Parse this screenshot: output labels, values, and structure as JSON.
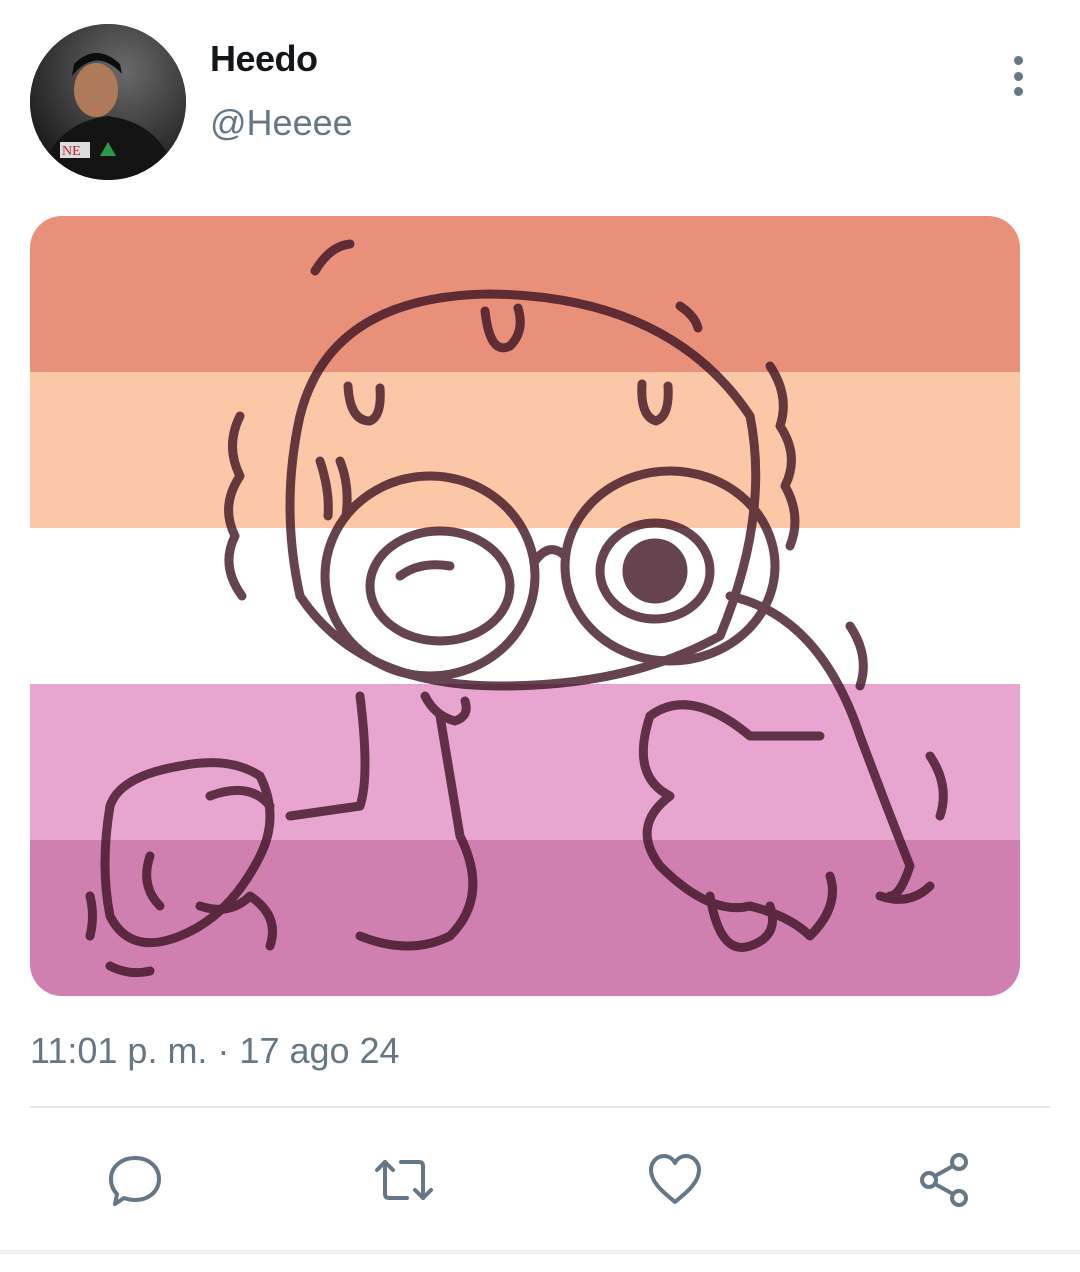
{
  "tweet": {
    "author": {
      "display_name": "Heedo",
      "handle": "@Heeee"
    },
    "media": {
      "flag_colors": [
        "#e8907a",
        "#fbc7a6",
        "#ffffff",
        "#e8a5cf",
        "#d07fb1"
      ],
      "drawing_color": "#3a1020"
    },
    "timestamp": "11:01 p. m. · 17 ago 24"
  },
  "actions": {
    "reply_icon": "speech-bubble-icon",
    "retweet_icon": "retweet-arrows-icon",
    "like_icon": "heart-outline-icon",
    "share_icon": "share-nodes-icon"
  },
  "colors": {
    "text_primary": "#14171a",
    "text_secondary": "#657786",
    "icon": "#657786",
    "divider": "#e1e6ea"
  }
}
